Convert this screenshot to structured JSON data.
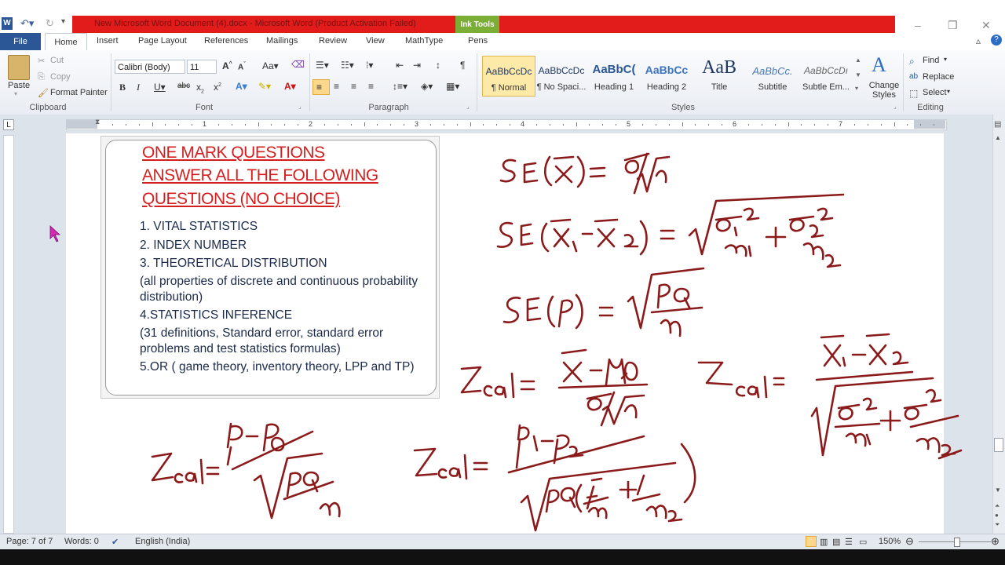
{
  "window": {
    "doc_title": "New Microsoft Word Document (4).docx  -  Microsoft Word (Product Activation Failed)",
    "context_tab": "Ink Tools",
    "controls": [
      "–",
      "❐",
      "✕"
    ]
  },
  "tabs": [
    "File",
    "Home",
    "Insert",
    "Page Layout",
    "References",
    "Mailings",
    "Review",
    "View",
    "MathType",
    "Pens"
  ],
  "clipboard": {
    "paste": "Paste",
    "cut": "Cut",
    "copy": "Copy",
    "format_painter": "Format Painter",
    "label": "Clipboard"
  },
  "font": {
    "name": "Calibri (Body)",
    "size": "11",
    "label": "Font"
  },
  "paragraph": {
    "label": "Paragraph"
  },
  "styles": {
    "label": "Styles",
    "items": [
      {
        "preview": "AaBbCcDc",
        "name": "¶ Normal"
      },
      {
        "preview": "AaBbCcDc",
        "name": "¶ No Spaci..."
      },
      {
        "preview": "AaBbC(",
        "name": "Heading 1"
      },
      {
        "preview": "AaBbCc",
        "name": "Heading 2"
      },
      {
        "preview": "AaB",
        "name": "Title"
      },
      {
        "preview": "AaBbCc.",
        "name": "Subtitle"
      },
      {
        "preview": "AaBbCcDı",
        "name": "Subtle Em..."
      }
    ],
    "change_styles": "Change Styles"
  },
  "editing": {
    "find": "Find",
    "replace": "Replace",
    "select": "Select",
    "label": "Editing"
  },
  "slide": {
    "headings": [
      "ONE MARK QUESTIONS",
      "ANSWER ALL THE FOLLOWING",
      "QUESTIONS (NO CHOICE)"
    ],
    "lines": [
      "1. VITAL STATISTICS",
      "2. INDEX NUMBER",
      "3. THEORETICAL DISTRIBUTION",
      "(all properties of discrete and continuous probability",
      "distribution)",
      "4.STATISTICS INFERENCE",
      "(31 definitions, Standard error, standard error",
      "problems and test statistics formulas)",
      "5.OR ( game theory, inventory theory, LPP and TP)"
    ]
  },
  "ruler_numbers": [
    "1",
    "2",
    "3",
    "4",
    "5",
    "6",
    "7"
  ],
  "status": {
    "page": "Page: 7 of 7",
    "words": "Words: 0",
    "language": "English (India)",
    "zoom": "150%"
  },
  "colors": {
    "file_tab": "#2b5797",
    "title_bar": "#e21b1b",
    "ink_tools": "#7bae35",
    "ink": "#8b1a1a",
    "slide_heading": "#d51f1f"
  }
}
